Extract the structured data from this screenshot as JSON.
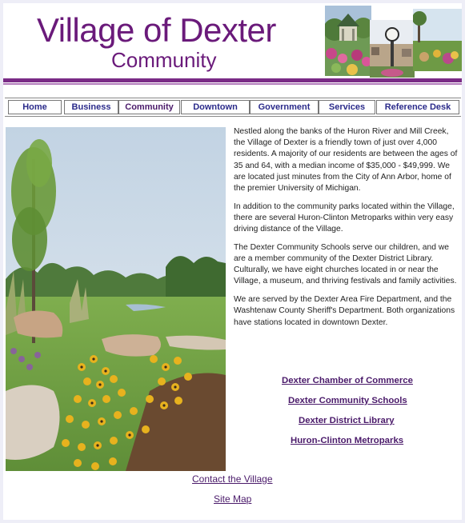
{
  "header": {
    "title": "Village of Dexter",
    "subtitle": "Community"
  },
  "nav": {
    "items": [
      {
        "label": "Home"
      },
      {
        "label": "Business"
      },
      {
        "label": "Community"
      },
      {
        "label": "Downtown"
      },
      {
        "label": "Government"
      },
      {
        "label": "Services"
      },
      {
        "label": "Reference Desk"
      }
    ],
    "active": "Community"
  },
  "content": {
    "paragraphs": [
      "Nestled along the banks of the Huron River and Mill Creek, the Village of Dexter is a friendly town of just over 4,000 residents. A majority of our residents are between the ages of 35 and 64, with a median income of $35,000 - $49,999. We are located just minutes from the City of Ann Arbor, home of the premier University of Michigan.",
      "In addition to the community parks located within the Village, there are several Huron-Clinton Metroparks within very easy driving distance of the Village.",
      "The Dexter Community Schools serve our children, and we are a member community of the Dexter District Library. Culturally, we have eight churches located in or near the Village, a museum, and thriving festivals and family activities.",
      "We are served by the Dexter Area Fire Department, and the Washtenaw County Sheriff's Department. Both organizations have stations located in downtown Dexter."
    ]
  },
  "partner_links": [
    "Dexter Chamber of Commerce",
    "Dexter Community Schools",
    "Dexter District Library",
    "Huron-Clinton Metroparks"
  ],
  "footer": {
    "contact": "Contact the Village",
    "sitemap": "Site Map"
  },
  "colors": {
    "brand_purple": "#6a1a7a",
    "nav_text": "#2a2a8a",
    "link": "#4a1a6a",
    "page_bg": "#eeeef7"
  }
}
